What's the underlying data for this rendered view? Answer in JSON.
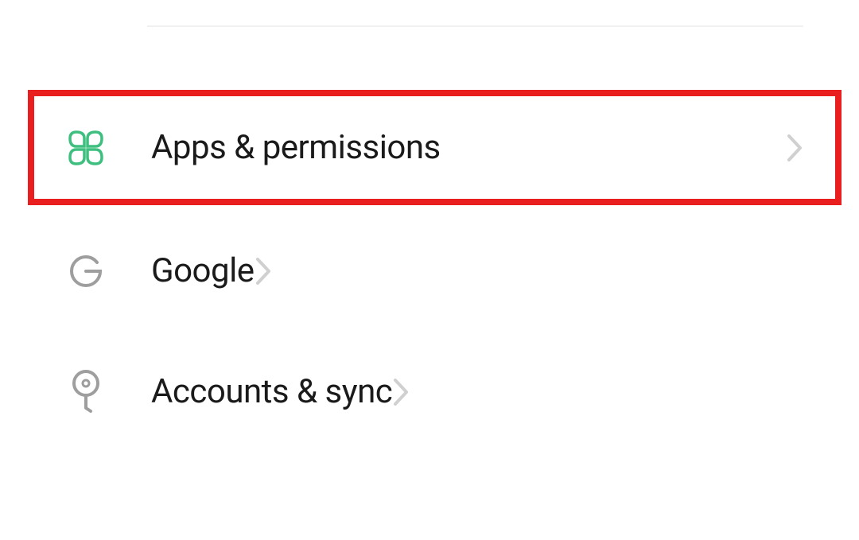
{
  "settings": {
    "items": [
      {
        "label": "Apps & permissions"
      },
      {
        "label": "Google"
      },
      {
        "label": "Accounts & sync"
      }
    ]
  }
}
